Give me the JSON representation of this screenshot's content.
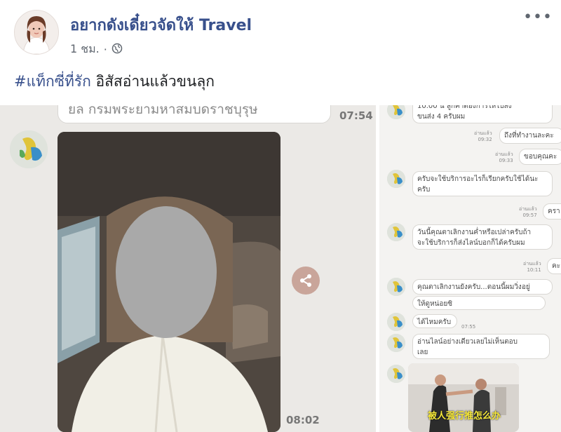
{
  "post": {
    "page_name": "อยากดังเดี๋ยวจัดให้ Travel",
    "time": "1 ชม.",
    "privacy_icon": "globe-icon",
    "more_icon": "more-icon",
    "caption_hashtag": "#แท็กซี่ที่รัก",
    "caption_text": "อิสัสอ่านแล้วขนลุก"
  },
  "left_chat": {
    "top_message": "ยล กรมพระยามหาสมบดราชบุรุษ",
    "top_time": "07:54",
    "photo_time": "08:02",
    "share_icon": "share-icon"
  },
  "right_chat": {
    "m1_text": "10.00 น ลูกค้าต้องการให้ไปส่ง",
    "m1_text2": "ขนส่ง 4 ครับผม",
    "read1": "อ่านแล้ว",
    "read1_time": "09:32",
    "out1": "ถึงที่ทำงานละคะ",
    "read2": "อ่านแล้ว",
    "read2_time": "09:33",
    "out2": "ขอบคุณคะ",
    "m2_text": "ครับจะใช้บริการอะไรก็เรียกครับใช้ได้นะ",
    "m2_text2": "ครับ",
    "read3": "อ่านแล้ว",
    "read3_time": "09:57",
    "out3": "ครา",
    "m3_text": "วันนี้คุณตาเลิกงานค่ำหรือเปล่าครับถ้า",
    "m3_text2": "จะใช้บริการก็ส่งไลน์บอกก็ได้ครับผม",
    "read4": "อ่านแล้ว",
    "read4_time": "10:11",
    "out4": "คะ",
    "m4_text": "คุณตาเลิกงานยังครับ...ตอนนี้ผมวิ่งอยู่",
    "m5_text": "ให้ดูหน่อยซิ",
    "m6_text": "ได้ไหมครับ",
    "m6_time": "07:55",
    "m7_text": "อ่านไลน์อย่างเดียวเลยไม่เห็นตอบ",
    "m7_text2": "เลย",
    "video_caption": "被人强行推怎么办"
  },
  "colors": {
    "link": "#38508c",
    "bubble_border": "#d9d7d3",
    "panel_bg": "#ebe9e6"
  }
}
